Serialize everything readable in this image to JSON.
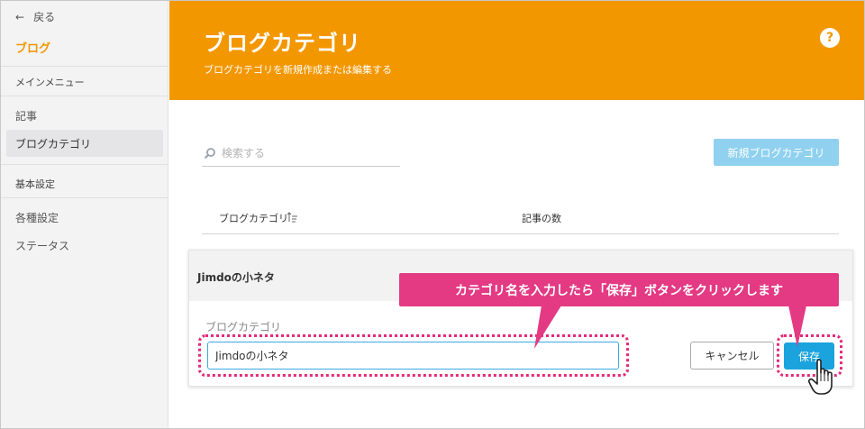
{
  "sidebar": {
    "back_label": "戻る",
    "blog_label": "ブログ",
    "main_menu_label": "メインメニュー",
    "items": [
      {
        "label": "記事"
      },
      {
        "label": "ブログカテゴリ"
      }
    ],
    "basic_settings_label": "基本設定",
    "settings_items": [
      {
        "label": "各種設定"
      },
      {
        "label": "ステータス"
      }
    ]
  },
  "header": {
    "title": "ブログカテゴリ",
    "subtitle": "ブログカテゴリを新規作成または編集する",
    "help_symbol": "?"
  },
  "search": {
    "placeholder": "検索する"
  },
  "new_category_button": "新規ブログカテゴリ",
  "table": {
    "columns": [
      "ブログカテゴリ",
      "記事の数"
    ]
  },
  "edit_panel": {
    "title": "Jimdoの小ネタ",
    "field_label": "ブログカテゴリ",
    "field_value": "Jimdoの小ネタ",
    "cancel_label": "キャンセル",
    "save_label": "保存"
  },
  "annotation": {
    "callout_text": "カテゴリ名を入力したら「保存」ボタンをクリックします"
  },
  "colors": {
    "accent": "#f39700",
    "primary": "#1aa3dd",
    "disabled_primary": "#8fd1ef",
    "annotation": "#e5297a"
  }
}
